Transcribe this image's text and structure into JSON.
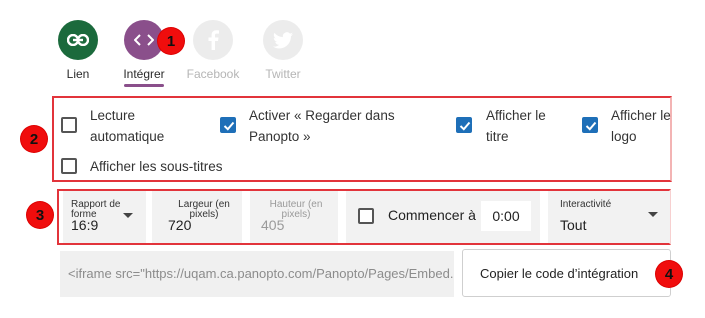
{
  "tabs": [
    {
      "id": "link",
      "label": "Lien",
      "icon": "link-icon",
      "color": "#1b6a3c",
      "fg": "#ffffff",
      "labelColor": "#2b2b2b",
      "active": false
    },
    {
      "id": "embed",
      "label": "Intégrer",
      "icon": "code-icon",
      "color": "#8a4f8b",
      "fg": "#ffffff",
      "labelColor": "#2b2b2b",
      "active": true
    },
    {
      "id": "facebook",
      "label": "Facebook",
      "icon": "facebook-icon",
      "color": "#ececec",
      "fg": "#ffffff",
      "labelColor": "#b5b5b5",
      "active": false
    },
    {
      "id": "twitter",
      "label": "Twitter",
      "icon": "twitter-icon",
      "color": "#ececec",
      "fg": "#ffffff",
      "labelColor": "#b5b5b5",
      "active": false
    }
  ],
  "markers": [
    "1",
    "2",
    "3",
    "4"
  ],
  "options": [
    {
      "label": "Lecture automatique",
      "checked": false
    },
    {
      "label": "Activer « Regarder dans Panopto »",
      "checked": true
    },
    {
      "label": "Afficher le titre",
      "checked": true
    },
    {
      "label": "Afficher le logo",
      "checked": true
    },
    {
      "label": "Afficher les sous-titres",
      "checked": false
    }
  ],
  "controls": {
    "ratio": {
      "label": "Rapport de forme",
      "value": "16:9"
    },
    "width": {
      "label": "Largeur (en pixels)",
      "value": "720"
    },
    "height": {
      "label": "Hauteur (en pixels)",
      "value": "405",
      "disabled": true
    },
    "start": {
      "label": "Commencer à",
      "value": "0:00",
      "checked": false
    },
    "interactivity": {
      "label": "Interactivité",
      "value": "Tout"
    }
  },
  "embed_code": "<iframe src=\"https://uqam.ca.panopto.com/Panopto/Pages/Embed.aspx",
  "copy_button": "Copier le code d’intégration",
  "colors": {
    "accent": "#8a4f8b",
    "checkbox": "#1e6fb8",
    "marker": "#f00d0d",
    "highlight_border": "#e2343b"
  }
}
